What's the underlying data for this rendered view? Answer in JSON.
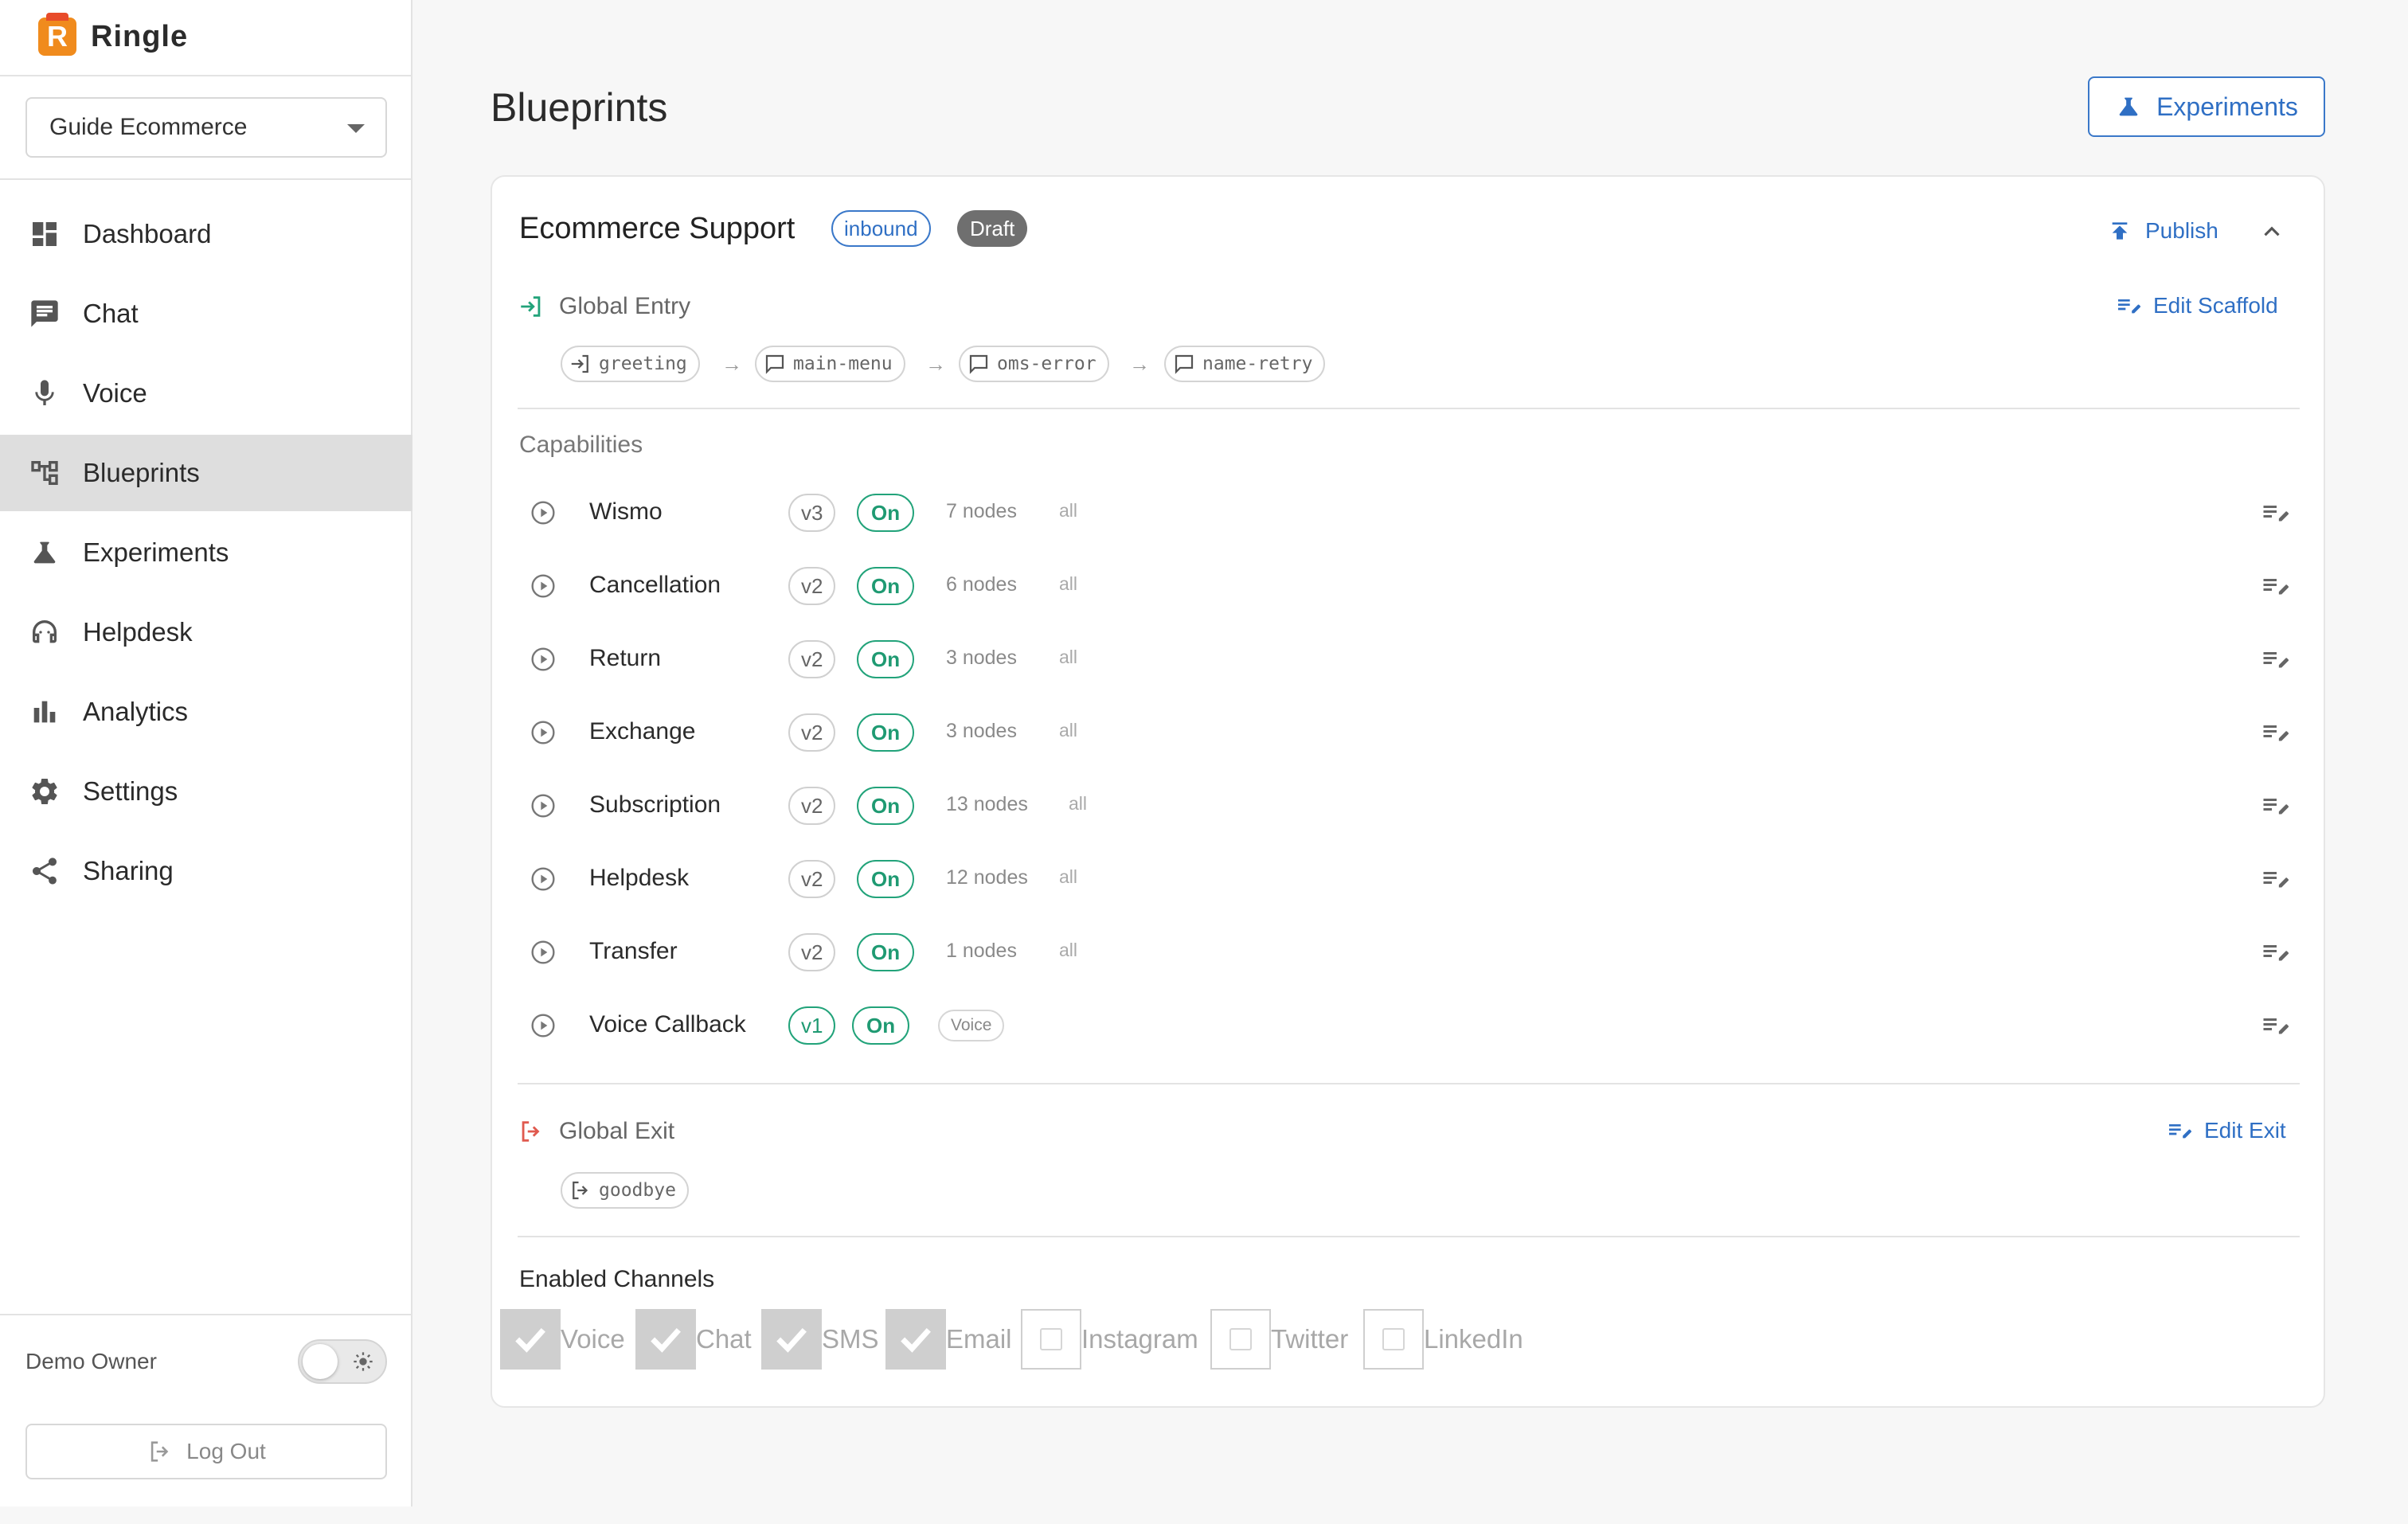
{
  "app": {
    "name": "Ringle"
  },
  "sidebar": {
    "org": "Guide Ecommerce",
    "items": [
      {
        "label": "Dashboard",
        "icon": "dashboard-icon"
      },
      {
        "label": "Chat",
        "icon": "chat-icon"
      },
      {
        "label": "Voice",
        "icon": "microphone-icon"
      },
      {
        "label": "Blueprints",
        "icon": "blueprint-icon",
        "active": true
      },
      {
        "label": "Experiments",
        "icon": "flask-icon"
      },
      {
        "label": "Helpdesk",
        "icon": "headset-icon"
      },
      {
        "label": "Analytics",
        "icon": "bar-chart-icon"
      },
      {
        "label": "Settings",
        "icon": "gear-icon"
      },
      {
        "label": "Sharing",
        "icon": "share-icon"
      }
    ],
    "user": "Demo Owner",
    "theme_toggle": "off",
    "logout_label": "Log Out"
  },
  "main": {
    "title": "Blueprints",
    "experiments_button": "Experiments",
    "blueprint": {
      "name": "Ecommerce Support",
      "direction": "inbound",
      "status": "Draft",
      "publish_label": "Publish",
      "global_entry": {
        "label": "Global Entry",
        "edit_label": "Edit Scaffold",
        "steps": [
          "greeting",
          "main-menu",
          "oms-error",
          "name-retry"
        ]
      },
      "capabilities_label": "Capabilities",
      "capabilities": [
        {
          "name": "Wismo",
          "version": "v3",
          "state": "On",
          "nodes": "7 nodes",
          "scope": "all"
        },
        {
          "name": "Cancellation",
          "version": "v2",
          "state": "On",
          "nodes": "6 nodes",
          "scope": "all"
        },
        {
          "name": "Return",
          "version": "v2",
          "state": "On",
          "nodes": "3 nodes",
          "scope": "all"
        },
        {
          "name": "Exchange",
          "version": "v2",
          "state": "On",
          "nodes": "3 nodes",
          "scope": "all"
        },
        {
          "name": "Subscription",
          "version": "v2",
          "state": "On",
          "nodes": "13 nodes",
          "scope": "all"
        },
        {
          "name": "Helpdesk",
          "version": "v2",
          "state": "On",
          "nodes": "12 nodes",
          "scope": "all"
        },
        {
          "name": "Transfer",
          "version": "v2",
          "state": "On",
          "nodes": "1 nodes",
          "scope": "all"
        },
        {
          "name": "Voice Callback",
          "version": "v1",
          "state": "On",
          "tag": "Voice"
        }
      ],
      "global_exit": {
        "label": "Global Exit",
        "edit_label": "Edit Exit",
        "steps": [
          "goodbye"
        ]
      },
      "channels_label": "Enabled Channels",
      "channels": [
        {
          "label": "Voice",
          "checked": true
        },
        {
          "label": "Chat",
          "checked": true
        },
        {
          "label": "SMS",
          "checked": true
        },
        {
          "label": "Email",
          "checked": true
        },
        {
          "label": "Instagram",
          "checked": false
        },
        {
          "label": "Twitter",
          "checked": false
        },
        {
          "label": "LinkedIn",
          "checked": false
        }
      ]
    }
  },
  "colors": {
    "accent": "#2f6fc4",
    "on_green": "#1f9a72",
    "exit_red": "#e05a4f",
    "entry_green": "#22a37a",
    "logo_orange": "#f08b1d"
  }
}
